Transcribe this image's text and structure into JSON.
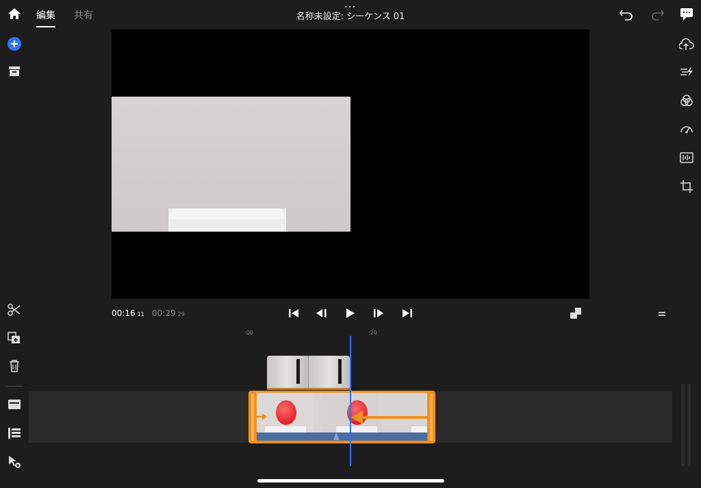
{
  "header": {
    "tab_edit": "編集",
    "tab_share": "共有",
    "title": "名称未設定: シーケンス 01",
    "more_dots": "•••"
  },
  "left_toolbar": {
    "icons": [
      "home-icon",
      "add-icon",
      "archive-icon",
      "scissors-icon",
      "duplicate-icon",
      "trash-icon",
      "track-icon",
      "list-icon",
      "add-pointer-icon"
    ]
  },
  "right_toolbar": {
    "icons": [
      "cloud-upload-icon",
      "speed-icon",
      "color-icon",
      "gauge-icon",
      "audio-icon",
      "crop-icon"
    ]
  },
  "transport": {
    "current_time": "00:16",
    "current_frame": "11",
    "total_time": "00:29",
    "total_frame": "29"
  },
  "timeline": {
    "ruler_start": ":00",
    "ruler_mark": ":20"
  },
  "colors": {
    "accent": "#2f73f0",
    "clip_selected": "#f0901d",
    "background": "#1d1d1d"
  }
}
